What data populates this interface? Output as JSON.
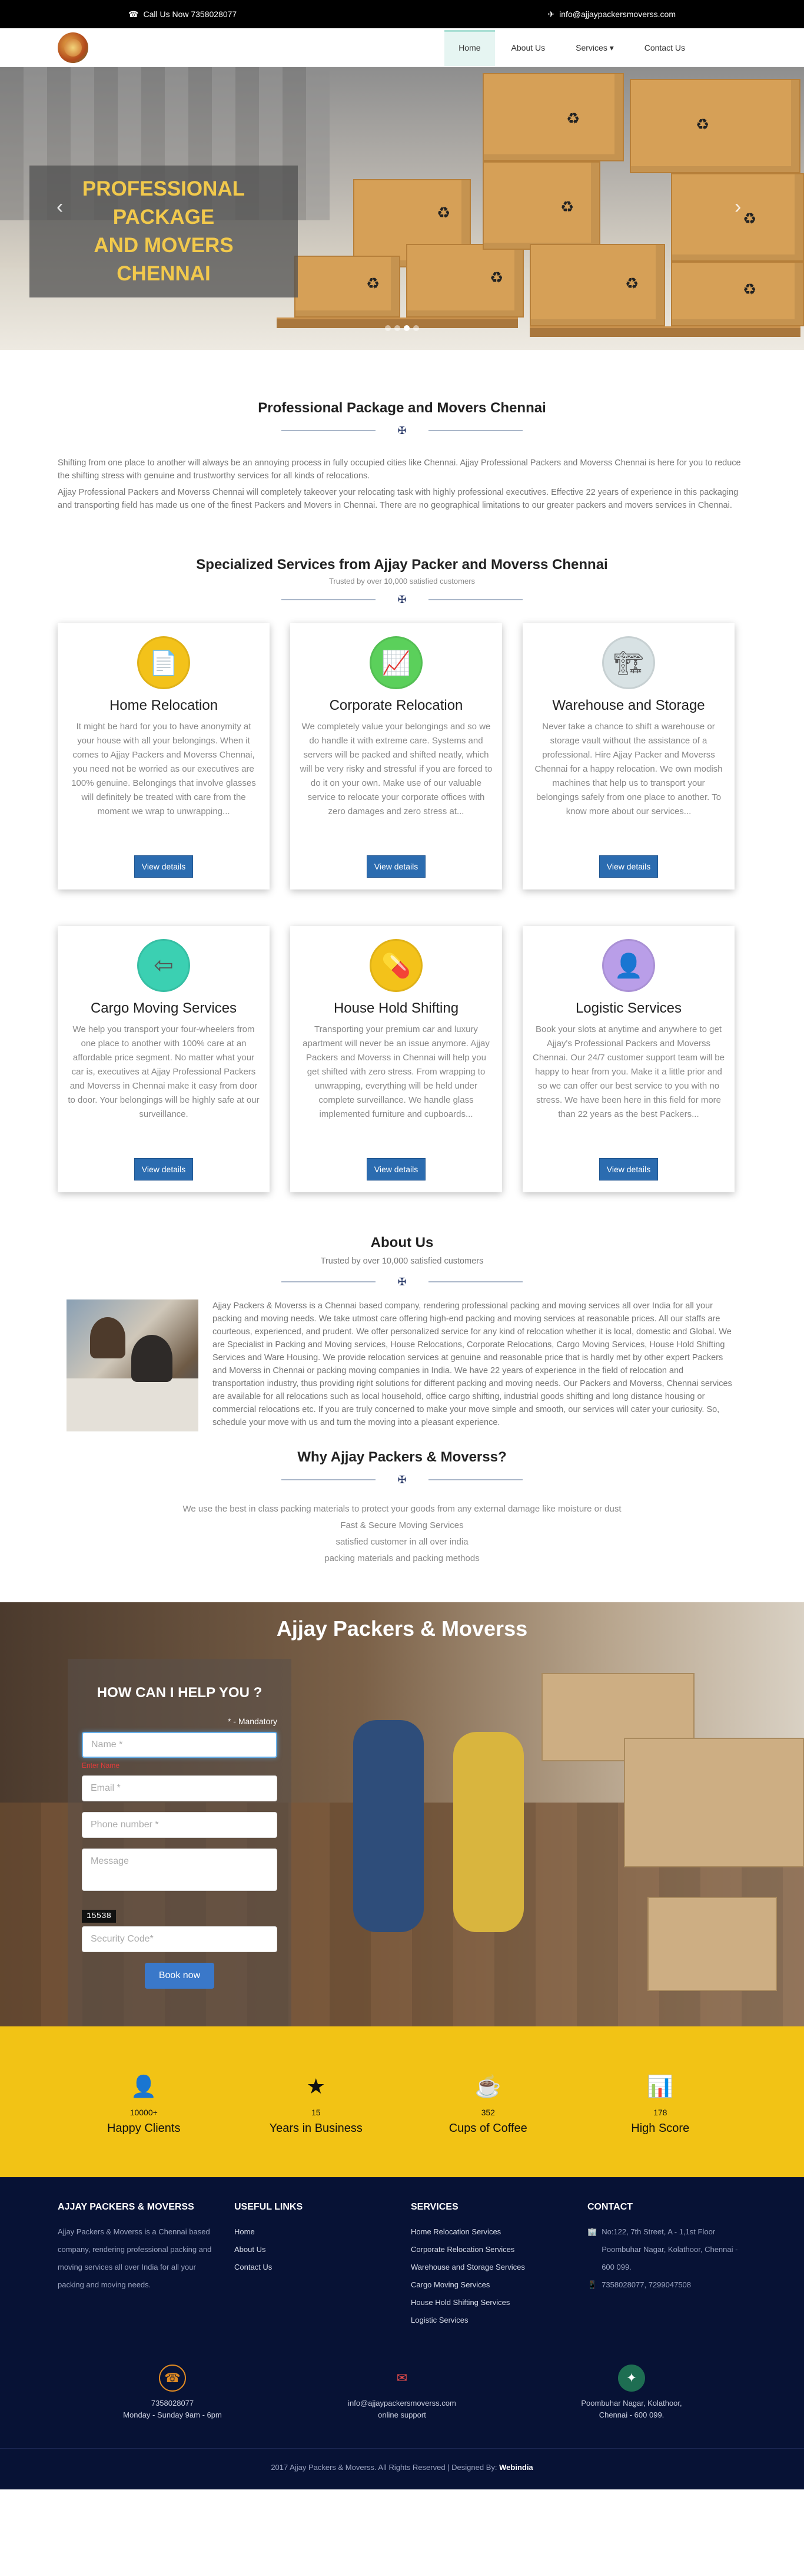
{
  "topbar": {
    "phone": "Call Us Now 7358028077",
    "email": "info@ajjaypackersmoverss.com"
  },
  "nav": {
    "items": [
      "Home",
      "About Us",
      "Services ▾",
      "Contact Us"
    ],
    "active": "Home"
  },
  "hero": {
    "title_line1": "PROFESSIONAL PACKAGE",
    "title_line2": "AND MOVERS CHENNAI",
    "prev": "‹",
    "next": "›"
  },
  "intro": {
    "title": "Professional Package and Movers Chennai",
    "p1": "Shifting from one place to another will always be an annoying process in fully occupied cities like Chennai. Ajjay Professional Packers and Moverss Chennai is here for you to reduce the shifting stress with genuine and trustworthy services for all kinds of relocations.",
    "p2": "Ajjay Professional Packers and Moverss Chennai will completely takeover your relocating task with highly professional executives. Effective 22 years of experience in this packaging and transporting field has made us one of the finest Packers and Movers in Chennai. There are no geographical limitations to our greater packers and movers services in Chennai."
  },
  "services": {
    "title": "Specialized Services from Ajjay Packer and Moverss Chennai",
    "subtitle": "Trusted by over 10,000 satisfied customers",
    "button": "View details",
    "cards": [
      {
        "title": "Home Relocation",
        "icon": "document-icon",
        "color": "#f3c21a",
        "text": "It might be hard for you to have anonymity at your house with all your belongings. When it comes to Ajjay Packers and Moverss Chennai, you need not be worried as our executives are 100% genuine. Belongings that involve glasses will definitely be treated with care from the moment we wrap to unwrapping..."
      },
      {
        "title": "Corporate Relocation",
        "icon": "chart-icon",
        "color": "#5bd05b",
        "text": "We completely value your belongings and so we do handle it with extreme care. Systems and servers will be packed and shifted neatly, which will be very risky and stressful if you are forced to do it on your own. Make use of our valuable service to relocate your corporate offices with zero damages and zero stress at..."
      },
      {
        "title": "Warehouse and Storage",
        "icon": "crane-icon",
        "color": "#d8e2e4",
        "text": "Never take a chance to shift a warehouse or storage vault without the assistance of a professional. Hire Ajjay Packer and Moverss Chennai for a happy relocation. We own modish machines that help us to transport your belongings safely from one place to another. To know more about our services..."
      },
      {
        "title": "Cargo Moving Services",
        "icon": "exit-door-icon",
        "color": "#3bd0b2",
        "text": "We help you transport your four-wheelers from one place to another with 100% care at an affordable price segment. No matter what your car is, executives at Ajjay Professional Packers and Moverss in Chennai make it easy from door to door. Your belongings will be highly safe at our surveillance."
      },
      {
        "title": "House Hold Shifting",
        "icon": "pill-icon",
        "color": "#f3c21a",
        "text": "Transporting your premium car and luxury apartment will never be an issue anymore. Ajjay Packers and Moverss in Chennai will help you get shifted with zero stress. From wrapping to unwrapping, everything will be held under complete surveillance. We handle glass implemented furniture and cupboards..."
      },
      {
        "title": "Logistic Services",
        "icon": "agent-icon",
        "color": "#b99ee8",
        "text": "Book your slots at anytime and anywhere to get Ajjay's Professional Packers and Moverss Chennai. Our 24/7 customer support team will be happy to hear from you. Make it a little prior and so we can offer our best service to you with no stress. We have been here in this field for more than 22 years as the best Packers..."
      }
    ]
  },
  "about": {
    "title": "About Us",
    "subtitle": "Trusted by over 10,000 satisfied customers",
    "text": "Ajjay Packers & Moverss is a Chennai based company, rendering professional packing and moving services all over India for all your packing and moving needs. We take utmost care offering high-end packing and moving services at reasonable prices. All our staffs are courteous, experienced, and prudent. We offer personalized service for any kind of relocation whether it is local, domestic and Global. We are Specialist in Packing and Moving services, House Relocations, Corporate Relocations, Cargo Moving Services, House Hold Shifting Services and Ware Housing. We provide relocation services at genuine and reasonable price that is hardly met by other expert Packers and Moverss in Chennai or packing moving companies in India. We have 22 years of experience in the field of relocation and transportation industry, thus providing right solutions for different packing and moving needs. Our Packers and Moverss, Chennai services are available for all relocations such as local household, office cargo shifting, industrial goods shifting and long distance housing or commercial relocations etc. If you are truly concerned to make your move simple and smooth, our services will cater your curiosity. So, schedule your move with us and turn the moving into a pleasant experience."
  },
  "why": {
    "title": "Why Ajjay Packers & Moverss?",
    "points": [
      "We use the best in class packing materials to protect your goods from any external damage like moisture or dust",
      "Fast & Secure Moving Services",
      "satisfied customer in all over india",
      "packing materials and packing methods"
    ]
  },
  "contact": {
    "title": "Ajjay Packers & Moverss",
    "form_title": "HOW CAN I HELP YOU ?",
    "mandatory": "* - Mandatory",
    "name_ph": "Name *",
    "name_error": "Enter Name",
    "email_ph": "Email *",
    "phone_ph": "Phone number *",
    "message_ph": "Message",
    "captcha": "15538",
    "security_ph": "Security Code*",
    "submit": "Book now"
  },
  "stats": [
    {
      "icon": "user-icon",
      "glyph": "👤",
      "number": "10000+",
      "label": "Happy Clients"
    },
    {
      "icon": "star-icon",
      "glyph": "★",
      "number": "15",
      "label": "Years in Business"
    },
    {
      "icon": "coffee-icon",
      "glyph": "☕",
      "number": "352",
      "label": "Cups of Coffee"
    },
    {
      "icon": "bar-chart-icon",
      "glyph": "📊",
      "number": "178",
      "label": "High Score"
    }
  ],
  "footer": {
    "col1_title": "AJJAY PACKERS & MOVERSS",
    "col1_text": "Ajjay Packers & Moverss is a Chennai based company, rendering professional packing and moving services all over India for all your packing and moving needs.",
    "col2_title": "USEFUL LINKS",
    "links": [
      "Home",
      "About Us",
      "Contact Us"
    ],
    "col3_title": "SERVICES",
    "services": [
      "Home Relocation Services",
      "Corporate Relocation Services",
      "Warehouse and Storage Services",
      "Cargo Moving Services",
      "House Hold Shifting Services",
      "Logistic Services"
    ],
    "col4_title": "CONTACT",
    "address": "No:122, 7th Street, A - 1,1st Floor Poombuhar Nagar, Kolathoor, Chennai - 600 099.",
    "phones": "7358028077, 7299047508",
    "c1_line1": "7358028077",
    "c1_line2": "Monday - Sunday 9am - 6pm",
    "c2_line1": "info@ajjaypackersmoverss.com",
    "c2_line2": "online support",
    "c3_line1": "Poombuhar Nagar, Kolathoor,",
    "c3_line2": "Chennai - 600 099.",
    "copyright": "2017 Ajjay Packers & Moverss. All Rights Reserved | Designed By:",
    "designer": "Webindia"
  }
}
